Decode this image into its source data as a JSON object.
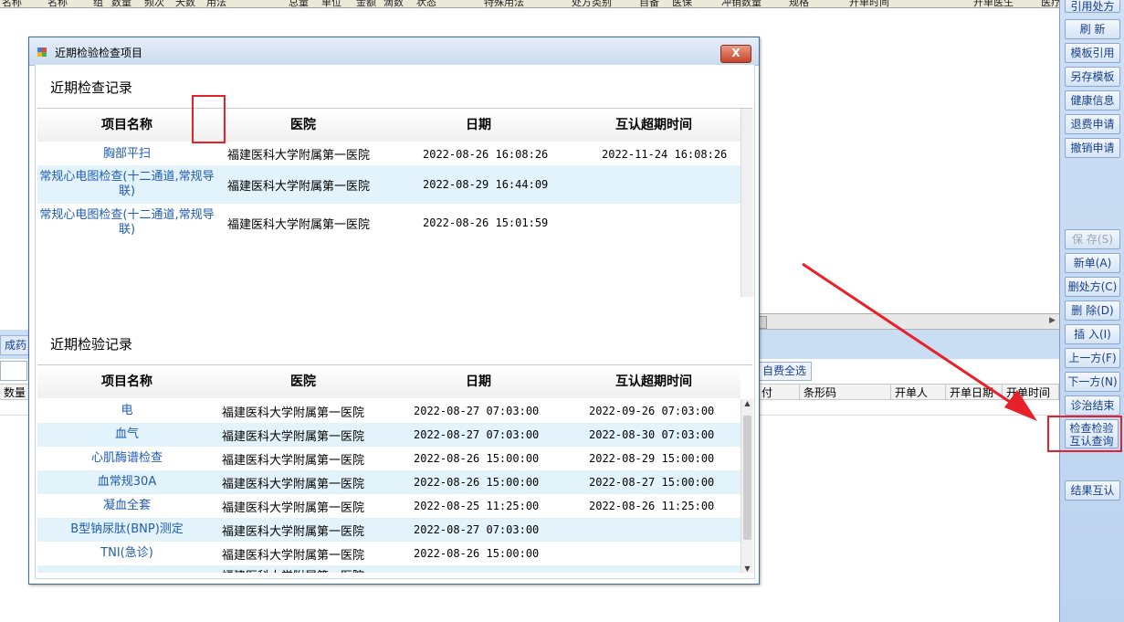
{
  "background": {
    "top_headers": [
      "名称",
      "组",
      "数量",
      "频次",
      "天数",
      "用法",
      "",
      "总量",
      "单位",
      "金额",
      "滴数",
      "状态",
      "特殊用法",
      "处方类别",
      "自备",
      "医保",
      "冲销数量",
      "规格",
      "开单时间",
      "开单医生",
      "医疗组"
    ],
    "tab_label": "成药",
    "selfpay_button": "自费全选",
    "left_header": "数量",
    "lower_headers": [
      "付",
      "条形码",
      "开单人",
      "开单日期",
      "开单时间"
    ]
  },
  "toolbar": {
    "top_partial": "引用处方",
    "refresh": "刷 新",
    "template_ref": "模板引用",
    "save_template": "另存模板",
    "health_info": "健康信息",
    "refund_apply": "退费申请",
    "cancel_apply": "撤销申请",
    "save": "保 存(S)",
    "new_order": "新单(A)",
    "delete_rx": "删处方(C)",
    "delete": "删 除(D)",
    "insert": "插 入(I)",
    "prev": "上一方(F)",
    "next": "下一方(N)",
    "finish": "诊治结束",
    "exam_query_l1": "检查检验",
    "exam_query_l2": "互认查询",
    "result_mutual": "结果互认"
  },
  "dialog": {
    "title": "近期检验检查项目",
    "close_label": "X",
    "exam_section_title": "近期检查记录",
    "lab_section_title": "近期检验记录",
    "columns": {
      "name": "项目名称",
      "hospital": "医院",
      "date": "日期",
      "expire": "互认超期时间"
    },
    "exam_rows": [
      {
        "name": "胸部平扫",
        "hospital": "福建医科大学附属第一医院",
        "date": "2022-08-26 16:08:26",
        "expire": "2022-11-24 16:08:26"
      },
      {
        "name": "常规心电图检查(十二通道,常规导联)",
        "hospital": "福建医科大学附属第一医院",
        "date": "2022-08-29 16:44:09",
        "expire": ""
      },
      {
        "name": "常规心电图检查(十二通道,常规导联)",
        "hospital": "福建医科大学附属第一医院",
        "date": "2022-08-26 15:01:59",
        "expire": ""
      }
    ],
    "lab_rows": [
      {
        "name": "电",
        "hospital": "福建医科大学附属第一医院",
        "date": "2022-08-27 07:03:00",
        "expire": "2022-09-26 07:03:00"
      },
      {
        "name": "血气",
        "hospital": "福建医科大学附属第一医院",
        "date": "2022-08-27 07:03:00",
        "expire": "2022-08-30 07:03:00"
      },
      {
        "name": "心肌酶谱检查",
        "hospital": "福建医科大学附属第一医院",
        "date": "2022-08-26 15:00:00",
        "expire": "2022-08-29 15:00:00"
      },
      {
        "name": "血常规30A",
        "hospital": "福建医科大学附属第一医院",
        "date": "2022-08-26 15:00:00",
        "expire": "2022-08-27 15:00:00"
      },
      {
        "name": "凝血全套",
        "hospital": "福建医科大学附属第一医院",
        "date": "2022-08-25 11:25:00",
        "expire": "2022-08-26 11:25:00"
      },
      {
        "name": "B型钠尿肽(BNP)测定",
        "hospital": "福建医科大学附属第一医院",
        "date": "2022-08-27 07:03:00",
        "expire": ""
      },
      {
        "name": "TNI(急诊)",
        "hospital": "福建医科大学附属第一医院",
        "date": "2022-08-26 15:00:00",
        "expire": ""
      }
    ],
    "lab_partial_row_hospital": "福建医科大学附属第一医院"
  },
  "colors": {
    "accent_red": "#e8202a",
    "link_blue": "#1f5bb5",
    "row_alt": "#e3f3fb",
    "toolbar_bg": "#c8dbf2"
  }
}
